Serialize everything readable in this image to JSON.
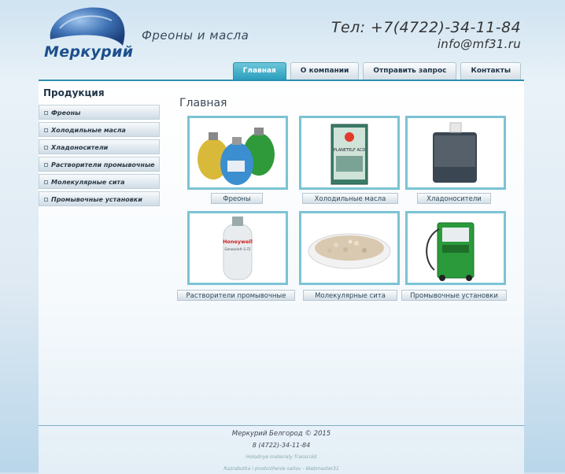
{
  "header": {
    "logo_text": "Меркурий",
    "slogan": "Фреоны и масла",
    "phone": "Тел: +7(4722)-34-11-84",
    "email": "info@mf31.ru"
  },
  "nav": {
    "items": [
      {
        "label": "Главная",
        "active": true
      },
      {
        "label": "О компании"
      },
      {
        "label": "Отправить запрос"
      },
      {
        "label": "Контакты"
      }
    ]
  },
  "sidebar": {
    "title": "Продукция",
    "items": [
      {
        "label": "Фреоны"
      },
      {
        "label": "Холодильные масла"
      },
      {
        "label": "Хладоносители"
      },
      {
        "label": "Растворители промывочные"
      },
      {
        "label": "Молекулярные сита"
      },
      {
        "label": "Промывочные установки"
      }
    ]
  },
  "main": {
    "title": "Главная",
    "products": [
      {
        "label": "Фреоны",
        "icon": "freon-cylinders-icon"
      },
      {
        "label": "Холодильные масла",
        "icon": "oil-can-icon",
        "can_text": "PLANETELF ACD"
      },
      {
        "label": "Хладоносители",
        "icon": "coolant-canister-icon"
      },
      {
        "label": "Растворители промывочные",
        "icon": "solvent-cylinder-icon",
        "brand": "Honeywell",
        "sub": "Genesolv® S-72"
      },
      {
        "label": "Молекулярные сита",
        "icon": "molecular-sieve-icon"
      },
      {
        "label": "Промывочные установки",
        "icon": "flushing-unit-icon"
      }
    ]
  },
  "footer": {
    "copyright": "Меркурий Белгород © 2015",
    "phone": "8 (4722)-34-11-84",
    "line3": "Holodnye materialy Transcold",
    "line4": "Razrabotka i prodvizhenie saitov - Webmaster31"
  },
  "colors": {
    "accent": "#2a9fbd",
    "brand": "#1d4f8c",
    "card_border": "#7cc3d4"
  }
}
